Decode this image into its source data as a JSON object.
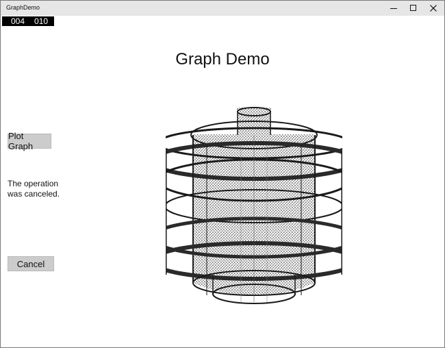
{
  "window": {
    "title": "GraphDemo",
    "controls": [
      "minimize-icon",
      "maximize-icon",
      "close-icon"
    ]
  },
  "counter": {
    "left": "004",
    "right": "010"
  },
  "main": {
    "heading": "Graph Demo",
    "plot_button_label": "Plot Graph",
    "status_line1": "The operation",
    "status_line2": "was canceled.",
    "cancel_button_label": "Cancel"
  },
  "colors": {
    "titlebar": "#e6e6e6",
    "button": "#cccccc",
    "counter_bg": "#000000",
    "graph_ink": "#1a1a1a"
  }
}
